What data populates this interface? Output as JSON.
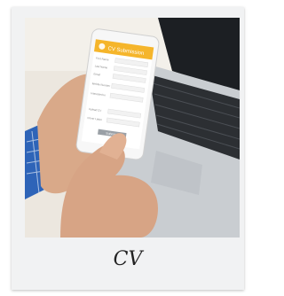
{
  "card": {
    "caption": "CV"
  },
  "phone_app": {
    "header_title": "CV Submission",
    "accent_color": "#f5b52b",
    "field_labels": [
      "First Name",
      "Last Name",
      "Email",
      "Mobile Number",
      "Interested In",
      "Upload CV",
      "Cover Letter"
    ],
    "submit_label": "Submit"
  },
  "scene": {
    "laptop_color": "#c9cdd1",
    "screen_color": "#1c1f23",
    "sleeve_color": "#2e64b8"
  }
}
